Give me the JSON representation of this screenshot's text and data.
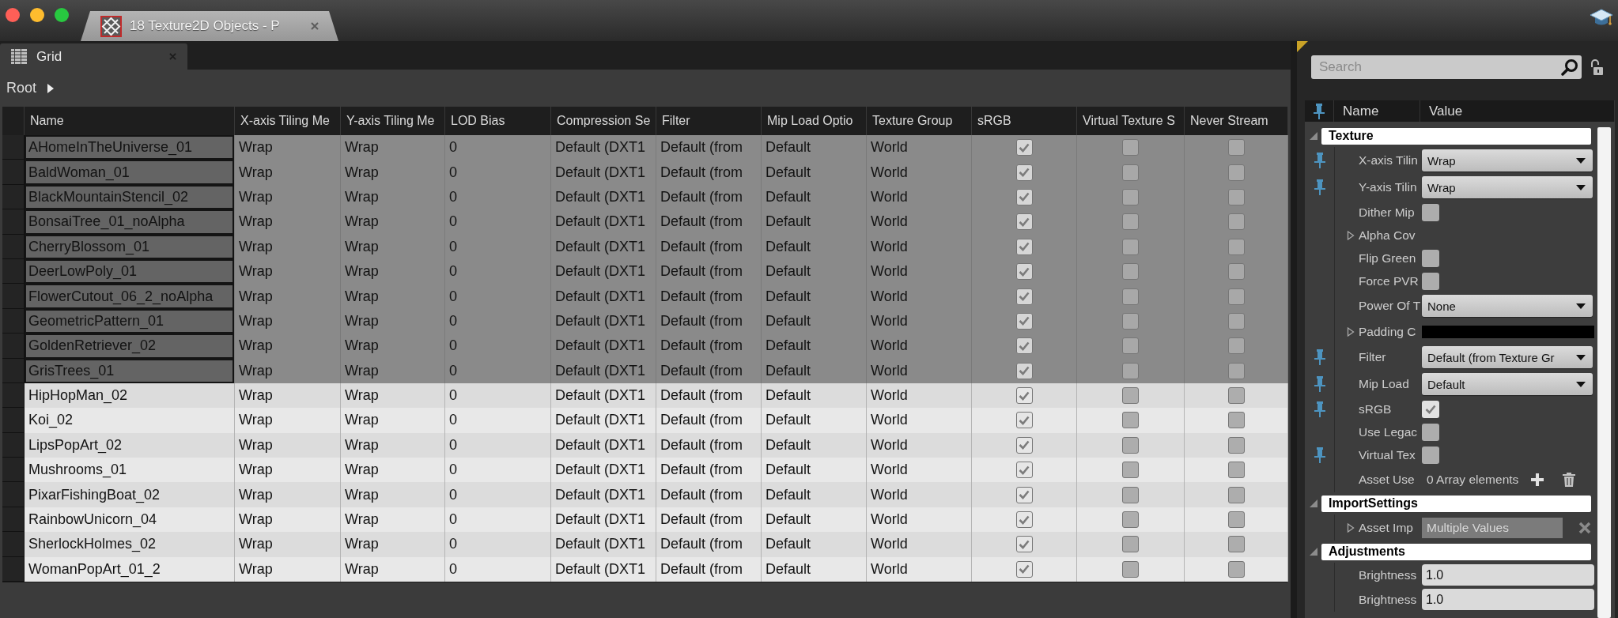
{
  "window": {
    "tabs": [
      {
        "title": "18 Texture2D Objects - P",
        "selected": true
      }
    ]
  },
  "editor": {
    "tabs": [
      {
        "title": "Grid",
        "selected": true
      }
    ],
    "breadcrumb": [
      "Root"
    ],
    "table": {
      "columns": [
        {
          "label": "Name",
          "kind": "text"
        },
        {
          "label": "X-axis Tiling Me",
          "kind": "text"
        },
        {
          "label": "Y-axis Tiling Me",
          "kind": "text"
        },
        {
          "label": "LOD Bias",
          "kind": "text"
        },
        {
          "label": "Compression Se",
          "kind": "text"
        },
        {
          "label": "Filter",
          "kind": "text"
        },
        {
          "label": "Mip Load Optio",
          "kind": "text"
        },
        {
          "label": "Texture Group",
          "kind": "text"
        },
        {
          "label": "sRGB",
          "kind": "checkbox"
        },
        {
          "label": "Virtual Texture S",
          "kind": "checkbox"
        },
        {
          "label": "Never Stream",
          "kind": "checkbox"
        }
      ],
      "rows": [
        {
          "selected": true,
          "values": [
            "AHomeInTheUniverse_01",
            "Wrap",
            "Wrap",
            "0",
            "Default (DXT1",
            "Default (from",
            "Default",
            "World",
            true,
            false,
            false
          ]
        },
        {
          "selected": true,
          "values": [
            "BaldWoman_01",
            "Wrap",
            "Wrap",
            "0",
            "Default (DXT1",
            "Default (from",
            "Default",
            "World",
            true,
            false,
            false
          ]
        },
        {
          "selected": true,
          "values": [
            "BlackMountainStencil_02",
            "Wrap",
            "Wrap",
            "0",
            "Default (DXT1",
            "Default (from",
            "Default",
            "World",
            true,
            false,
            false
          ]
        },
        {
          "selected": true,
          "values": [
            "BonsaiTree_01_noAlpha",
            "Wrap",
            "Wrap",
            "0",
            "Default (DXT1",
            "Default (from",
            "Default",
            "World",
            true,
            false,
            false
          ]
        },
        {
          "selected": true,
          "values": [
            "CherryBlossom_01",
            "Wrap",
            "Wrap",
            "0",
            "Default (DXT1",
            "Default (from",
            "Default",
            "World",
            true,
            false,
            false
          ]
        },
        {
          "selected": true,
          "values": [
            "DeerLowPoly_01",
            "Wrap",
            "Wrap",
            "0",
            "Default (DXT1",
            "Default (from",
            "Default",
            "World",
            true,
            false,
            false
          ]
        },
        {
          "selected": true,
          "values": [
            "FlowerCutout_06_2_noAlpha",
            "Wrap",
            "Wrap",
            "0",
            "Default (DXT1",
            "Default (from",
            "Default",
            "World",
            true,
            false,
            false
          ]
        },
        {
          "selected": true,
          "values": [
            "GeometricPattern_01",
            "Wrap",
            "Wrap",
            "0",
            "Default (DXT1",
            "Default (from",
            "Default",
            "World",
            true,
            false,
            false
          ]
        },
        {
          "selected": true,
          "values": [
            "GoldenRetriever_02",
            "Wrap",
            "Wrap",
            "0",
            "Default (DXT1",
            "Default (from",
            "Default",
            "World",
            true,
            false,
            false
          ]
        },
        {
          "selected": true,
          "values": [
            "GrisTrees_01",
            "Wrap",
            "Wrap",
            "0",
            "Default (DXT1",
            "Default (from",
            "Default",
            "World",
            true,
            false,
            false
          ]
        },
        {
          "selected": false,
          "values": [
            "HipHopMan_02",
            "Wrap",
            "Wrap",
            "0",
            "Default (DXT1",
            "Default (from",
            "Default",
            "World",
            true,
            false,
            false
          ]
        },
        {
          "selected": false,
          "values": [
            "Koi_02",
            "Wrap",
            "Wrap",
            "0",
            "Default (DXT1",
            "Default (from",
            "Default",
            "World",
            true,
            false,
            false
          ]
        },
        {
          "selected": false,
          "values": [
            "LipsPopArt_02",
            "Wrap",
            "Wrap",
            "0",
            "Default (DXT1",
            "Default (from",
            "Default",
            "World",
            true,
            false,
            false
          ]
        },
        {
          "selected": false,
          "values": [
            "Mushrooms_01",
            "Wrap",
            "Wrap",
            "0",
            "Default (DXT1",
            "Default (from",
            "Default",
            "World",
            true,
            false,
            false
          ]
        },
        {
          "selected": false,
          "values": [
            "PixarFishingBoat_02",
            "Wrap",
            "Wrap",
            "0",
            "Default (DXT1",
            "Default (from",
            "Default",
            "World",
            true,
            false,
            false
          ]
        },
        {
          "selected": false,
          "values": [
            "RainbowUnicorn_04",
            "Wrap",
            "Wrap",
            "0",
            "Default (DXT1",
            "Default (from",
            "Default",
            "World",
            true,
            false,
            false
          ]
        },
        {
          "selected": false,
          "values": [
            "SherlockHolmes_02",
            "Wrap",
            "Wrap",
            "0",
            "Default (DXT1",
            "Default (from",
            "Default",
            "World",
            true,
            false,
            false
          ]
        },
        {
          "selected": false,
          "values": [
            "WomanPopArt_01_2",
            "Wrap",
            "Wrap",
            "0",
            "Default (DXT1",
            "Default (from",
            "Default",
            "World",
            true,
            false,
            false
          ]
        }
      ]
    }
  },
  "details": {
    "search": {
      "placeholder": "Search"
    },
    "columns": [
      "Name",
      "Value"
    ],
    "categories": [
      {
        "title": "Texture",
        "expanded": true,
        "properties": [
          {
            "kind": "dropdown",
            "label": "X-axis Tilin",
            "pinned": true,
            "value": "Wrap"
          },
          {
            "kind": "dropdown",
            "label": "Y-axis Tilin",
            "pinned": true,
            "value": "Wrap"
          },
          {
            "kind": "checkbox",
            "label": "Dither Mip",
            "pinned": false,
            "checked": false
          },
          {
            "kind": "group",
            "label": "Alpha Cov",
            "pinned": false,
            "expanded": false
          },
          {
            "kind": "checkbox",
            "label": "Flip Green",
            "pinned": false,
            "checked": false
          },
          {
            "kind": "checkbox",
            "label": "Force PVR",
            "pinned": false,
            "checked": false
          },
          {
            "kind": "dropdown",
            "label": "Power Of T",
            "pinned": false,
            "value": "None"
          },
          {
            "kind": "color",
            "label": "Padding C",
            "pinned": false,
            "expanded": false,
            "color": "#000000"
          },
          {
            "kind": "dropdown",
            "label": "Filter",
            "pinned": true,
            "value": "Default (from Texture Gr"
          },
          {
            "kind": "dropdown",
            "label": "Mip Load",
            "pinned": true,
            "value": "Default"
          },
          {
            "kind": "checkbox",
            "label": "sRGB",
            "pinned": true,
            "checked": true
          },
          {
            "kind": "checkbox",
            "label": "Use Legac",
            "pinned": false,
            "checked": false
          },
          {
            "kind": "checkbox",
            "label": "Virtual Tex",
            "pinned": true,
            "checked": false
          },
          {
            "kind": "array",
            "label": "Asset Use",
            "pinned": false,
            "value": "0 Array elements"
          }
        ]
      },
      {
        "title": "ImportSettings",
        "expanded": true,
        "properties": [
          {
            "kind": "text",
            "label": "Asset Imp",
            "pinned": false,
            "expanded": false,
            "value": "Multiple Values"
          }
        ]
      },
      {
        "title": "Adjustments",
        "expanded": true,
        "properties": [
          {
            "kind": "number",
            "label": "Brightness",
            "pinned": false,
            "value": "1.0"
          },
          {
            "kind": "number",
            "label": "Brightness",
            "pinned": false,
            "value": "1.0"
          }
        ]
      }
    ]
  }
}
